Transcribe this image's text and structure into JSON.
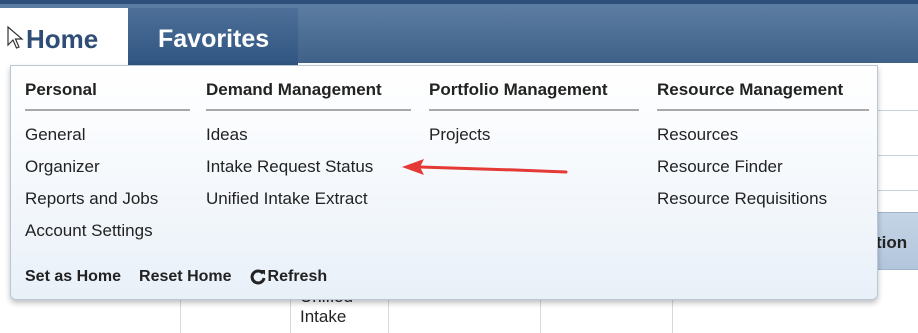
{
  "nav": {
    "home_label": "Home",
    "favorites_label": "Favorites"
  },
  "menu": {
    "columns": [
      {
        "header": "Personal",
        "items": [
          "General",
          "Organizer",
          "Reports and Jobs",
          "Account Settings"
        ]
      },
      {
        "header": "Demand Management",
        "items": [
          "Ideas",
          "Intake Request Status",
          "Unified Intake Extract"
        ]
      },
      {
        "header": "Portfolio Management",
        "items": [
          "Projects"
        ]
      },
      {
        "header": "Resource Management",
        "items": [
          "Resources",
          "Resource Finder",
          "Resource Requisitions"
        ]
      }
    ],
    "footer": {
      "set_as_home": "Set as Home",
      "reset_home": "Reset Home",
      "refresh": "Refresh"
    }
  },
  "background": {
    "header_partial": "tion",
    "cell_lines": [
      "Unified",
      "Intake"
    ]
  },
  "colors": {
    "nav_bar": "#3f6188",
    "home_text": "#2f4e75",
    "annotation_arrow": "#e53935"
  }
}
